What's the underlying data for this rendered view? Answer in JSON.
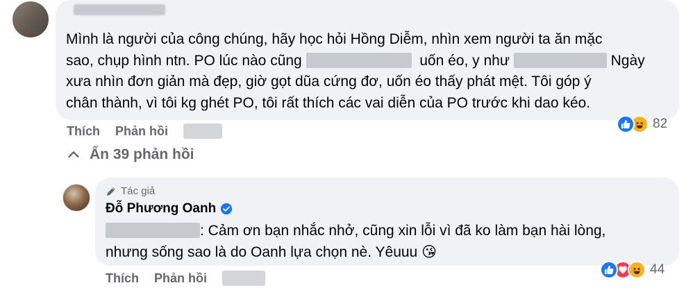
{
  "comment": {
    "text_line1": "Mình là người của công chúng, hãy học hỏi Hồng Diễm, nhìn xem người ta ăn mặc",
    "text_line2a": "sao, chụp hình ntn. PO lúc nào cũng",
    "text_line2b": "uốn éo, y như",
    "text_line2c": "Ngày",
    "text_line3": "xưa nhìn đơn giản mà đẹp, giờ gọt dũa cứng đơ, uốn éo thấy phát mệt. Tôi góp ý",
    "text_line4": "chân thành, vì tôi kg ghét PO, tôi rất thích các vai diễn của PO trước khi dao kéo.",
    "reaction_count": "82",
    "reaction_icons": [
      "like-icon",
      "haha-icon"
    ],
    "like_label": "Thích",
    "reply_label": "Phản hồi"
  },
  "hide_replies_label": "Ẩn 39 phản hồi",
  "reply": {
    "author_badge": "Tác giả",
    "author_name": "Đỗ Phương Oanh",
    "text_line1": ": Cảm ơn bạn nhắc nhở, cũng xin lỗi vì đã ko làm bạn hài lòng,",
    "text_line2": "nhưng sống sao là do Oanh lựa chọn nè. Yêuuu",
    "emoji": "😘",
    "reaction_count": "44",
    "reaction_icons": [
      "like-icon",
      "love-icon",
      "haha-icon"
    ],
    "like_label": "Thích",
    "reply_label": "Phản hồi"
  },
  "colors": {
    "bubble": "#f0f2f5",
    "secondary_text": "#65676b",
    "like_blue": "#1877f2",
    "love_red": "#f33e58",
    "haha_yellow": "#f7b125"
  }
}
